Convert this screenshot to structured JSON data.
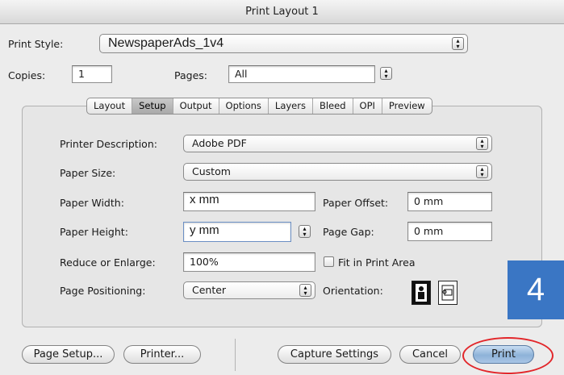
{
  "window": {
    "title": "Print Layout 1"
  },
  "print_style": {
    "label": "Print Style:",
    "value": "NewspaperAds_1v4"
  },
  "copies": {
    "label": "Copies:",
    "value": "1"
  },
  "pages": {
    "label": "Pages:",
    "value": "All"
  },
  "tabs": [
    "Layout",
    "Setup",
    "Output",
    "Options",
    "Layers",
    "Bleed",
    "OPI",
    "Preview"
  ],
  "active_tab": "Setup",
  "setup": {
    "printer_description": {
      "label": "Printer Description:",
      "value": "Adobe PDF"
    },
    "paper_size": {
      "label": "Paper Size:",
      "value": "Custom"
    },
    "paper_width": {
      "label": "Paper Width:",
      "value": "x mm"
    },
    "paper_offset": {
      "label": "Paper Offset:",
      "value": "0 mm"
    },
    "paper_height": {
      "label": "Paper Height:",
      "value": "y mm"
    },
    "page_gap": {
      "label": "Page Gap:",
      "value": "0 mm"
    },
    "reduce_enlarge": {
      "label": "Reduce or Enlarge:",
      "value": "100%"
    },
    "fit_in_print_area": {
      "label": "Fit in Print Area",
      "checked": false
    },
    "page_positioning": {
      "label": "Page Positioning:",
      "value": "Center"
    },
    "orientation": {
      "label": "Orientation:",
      "options": [
        "portrait-icon",
        "landscape-icon"
      ],
      "selected": "portrait-icon"
    }
  },
  "buttons": {
    "page_setup": "Page Setup...",
    "printer": "Printer...",
    "capture_settings": "Capture Settings",
    "cancel": "Cancel",
    "print": "Print"
  },
  "annotation": {
    "step_number": "4",
    "badge_color": "#3a76c4",
    "highlight_color": "#e2262a"
  }
}
